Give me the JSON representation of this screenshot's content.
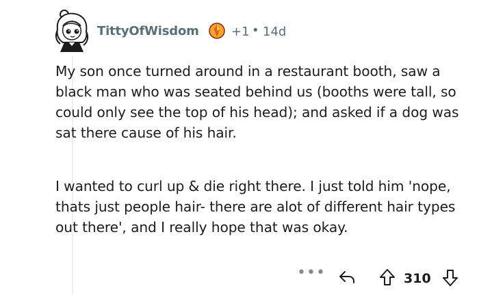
{
  "comment": {
    "author": "TittyOfWisdom",
    "award_count": "+1",
    "separator": "•",
    "age": "14d",
    "paragraphs": [
      "My son once turned around in a restaurant booth, saw a black man who was seated behind us (booths were tall, so could only see the top of his head); and asked if a dog was sat there cause of his hair.",
      "I wanted to curl up & die right there. I just told him 'nope, thats just people hair- there are alot of different hair types out there', and I really hope that was okay."
    ]
  },
  "actions": {
    "more": "•••",
    "reply_icon": "reply-arrow-icon",
    "upvote_icon": "upvote-arrow-icon",
    "score": "310",
    "downvote_icon": "downvote-arrow-icon"
  },
  "colors": {
    "meta_text": "#576f76",
    "body_text": "#1c1c1c",
    "icon_grey": "#878a8c",
    "award_orange": "#e8562a"
  }
}
